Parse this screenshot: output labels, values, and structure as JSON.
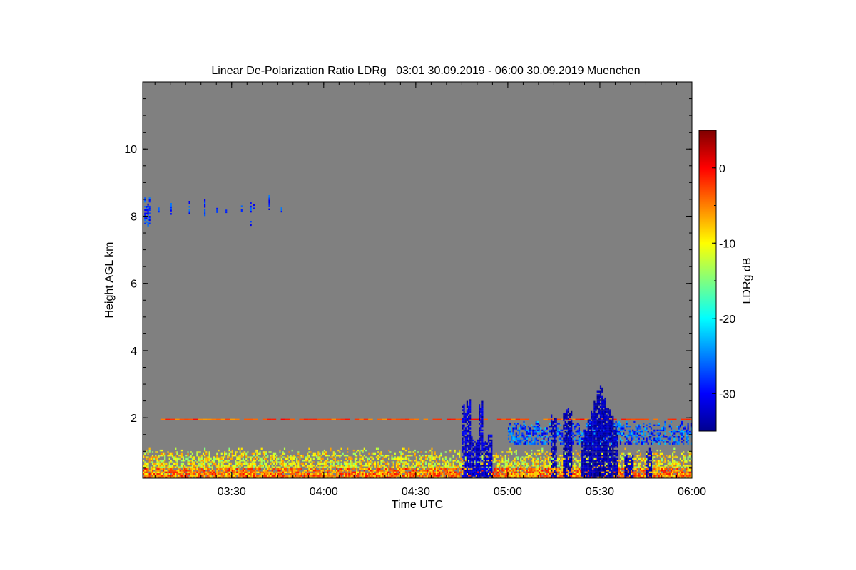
{
  "chart_data": {
    "type": "heatmap",
    "title": "Linear De-Polarization Ratio LDRg   03:01 30.09.2019 - 06:00 30.09.2019 Muenchen",
    "xlabel": "Time UTC",
    "ylabel": "Height AGL km",
    "colorbar_label": "LDRg dB",
    "xlim_minutes_utc": [
      181,
      360
    ],
    "x_ticks": [
      {
        "label": "03:30",
        "value": 210
      },
      {
        "label": "04:00",
        "value": 240
      },
      {
        "label": "04:30",
        "value": 270
      },
      {
        "label": "05:00",
        "value": 300
      },
      {
        "label": "05:30",
        "value": 330
      },
      {
        "label": "06:00",
        "value": 360
      }
    ],
    "ylim_km": [
      0.2,
      12.0
    ],
    "y_ticks": [
      {
        "label": "2",
        "value": 2
      },
      {
        "label": "4",
        "value": 4
      },
      {
        "label": "6",
        "value": 6
      },
      {
        "label": "8",
        "value": 8
      },
      {
        "label": "10",
        "value": 10
      }
    ],
    "colorbar_range_db": [
      -35,
      5
    ],
    "colorbar_ticks": [
      {
        "label": "0",
        "value": 0
      },
      {
        "label": "-10",
        "value": -10
      },
      {
        "label": "-20",
        "value": -20
      },
      {
        "label": "-30",
        "value": -30
      }
    ],
    "background_color": "#808080",
    "features": [
      {
        "name": "Boundary layer aerosol",
        "t_start": 181,
        "t_end": 360,
        "h_bottom": 0.2,
        "h_top": 1.0,
        "ldr_db": -8
      },
      {
        "name": "Thin aerosol line",
        "t_start": 187,
        "t_end": 360,
        "h": 1.95,
        "ldr_db": -3
      },
      {
        "name": "Cirrus near 8 km",
        "t_start": 181,
        "t_end": 226,
        "h_bottom": 7.6,
        "h_top": 8.6,
        "ldr_db": -28
      },
      {
        "name": "Low cloud 04:45-04:55",
        "t_start": 285,
        "t_end": 295,
        "h_bottom": 0.2,
        "h_top": 2.6,
        "ldr_db": -32
      },
      {
        "name": "Stratiform cloud",
        "t_start": 300,
        "t_end": 360,
        "h_bottom": 1.2,
        "h_top": 1.9,
        "ldr_db": -27
      },
      {
        "name": "Convective cloud 05:30",
        "t_start": 324,
        "t_end": 336,
        "h_bottom": 0.2,
        "h_top": 3.05,
        "ldr_db": -33
      }
    ]
  }
}
